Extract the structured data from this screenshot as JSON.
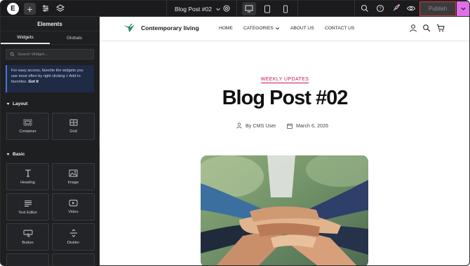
{
  "topbar": {
    "document_title": "Blog Post #02",
    "publish_label": "Publish",
    "devices": [
      "desktop",
      "tablet",
      "mobile"
    ],
    "accent_pink": "#e070e8",
    "publish_outline": "#d93a3a"
  },
  "sidebar": {
    "title": "Elements",
    "tabs": [
      "Widgets",
      "Globals"
    ],
    "search_placeholder": "Search Widget...",
    "notice_text": "For easy access, favorite the widgets you use most often by right clicking > Add to favorites.",
    "notice_link": "Got It",
    "categories": {
      "layout": {
        "label": "Layout",
        "widgets": [
          {
            "label": "Container",
            "icon": "container-icon"
          },
          {
            "label": "Grid",
            "icon": "grid-icon"
          }
        ]
      },
      "basic": {
        "label": "Basic",
        "widgets": [
          {
            "label": "Heading",
            "icon": "heading-icon"
          },
          {
            "label": "Image",
            "icon": "image-icon"
          },
          {
            "label": "Text Editor",
            "icon": "text-editor-icon"
          },
          {
            "label": "Video",
            "icon": "video-icon"
          },
          {
            "label": "Button",
            "icon": "button-icon"
          },
          {
            "label": "Divider",
            "icon": "divider-icon"
          }
        ]
      }
    }
  },
  "site": {
    "brand": "Contemporary living",
    "brand_color": "#2a8a6e",
    "nav": [
      "HOME",
      "CATEGORIES",
      "ABOUT US",
      "CONTACT US"
    ]
  },
  "post": {
    "category": "WEEKLY UPDATES",
    "category_color": "#c2185b",
    "title": "Blog Post #02",
    "author": "By CMS User",
    "date": "March 6, 2026"
  }
}
